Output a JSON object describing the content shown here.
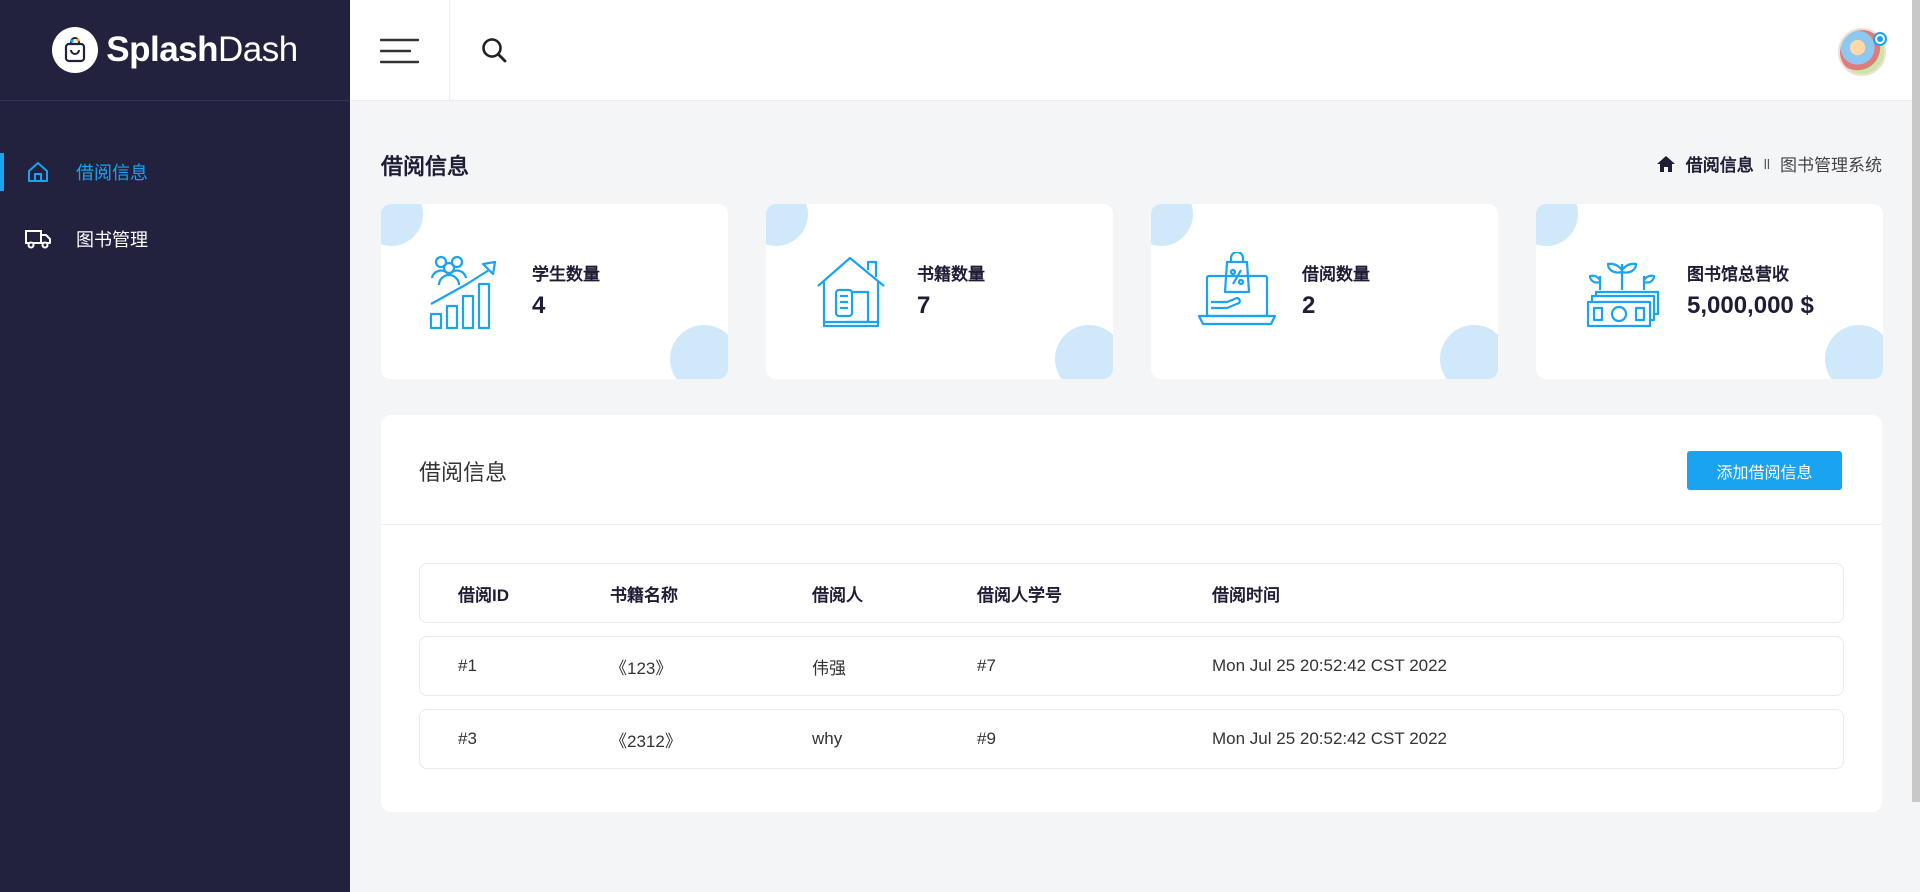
{
  "brand": {
    "bold": "Splash",
    "light": "Dash"
  },
  "sidebar": {
    "items": [
      {
        "label": "借阅信息",
        "icon": "home-icon",
        "active": true
      },
      {
        "label": "图书管理",
        "icon": "truck-icon",
        "active": false
      }
    ]
  },
  "header": {
    "menu_icon": "hamburger-menu-icon",
    "search_icon": "search-icon"
  },
  "page": {
    "title": "借阅信息",
    "breadcrumb": {
      "current": "借阅信息",
      "separator": "ll",
      "system": "图书管理系统"
    }
  },
  "stats": [
    {
      "label": "学生数量",
      "value": "4",
      "icon": "students-growth-icon"
    },
    {
      "label": "书籍数量",
      "value": "7",
      "icon": "book-house-icon"
    },
    {
      "label": "借阅数量",
      "value": "2",
      "icon": "laptop-shopping-icon"
    },
    {
      "label": "图书馆总营收",
      "value": "5,000,000 $",
      "icon": "money-plant-icon"
    }
  ],
  "panel": {
    "title": "借阅信息",
    "add_button": "添加借阅信息",
    "columns": [
      "借阅ID",
      "书籍名称",
      "借阅人",
      "借阅人学号",
      "借阅时间"
    ],
    "rows": [
      [
        "#1",
        "《123》",
        "伟强",
        "#7",
        "Mon Jul 25 20:52:42 CST 2022"
      ],
      [
        "#3",
        "《2312》",
        "why",
        "#9",
        "Mon Jul 25 20:52:42 CST 2022"
      ]
    ]
  },
  "colors": {
    "accent": "#1aa3f0",
    "sidebar_bg": "#22223f",
    "blob": "#cfe9fb"
  }
}
